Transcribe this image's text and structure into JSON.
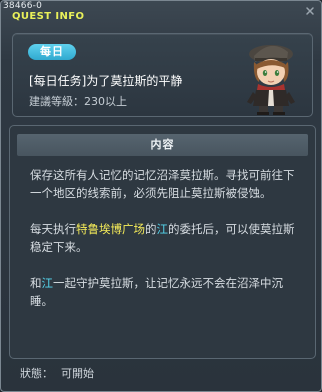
{
  "window": {
    "id": "38466-0",
    "title": "QUEST INFO"
  },
  "quest": {
    "badge": "每日",
    "name": "[每日任务]为了莫拉斯的平静",
    "level": "建議等級：230以上"
  },
  "content": {
    "header": "内容",
    "paragraphs": [
      {
        "segments": [
          {
            "text": "保存这所有人记忆的记忆沼泽莫拉斯。寻找可前往下一个地区的线索前，必须先阻止莫拉斯被侵蚀。",
            "style": "plain"
          }
        ]
      },
      {
        "segments": [
          {
            "text": "每天执行",
            "style": "plain"
          },
          {
            "text": "特鲁埃博广场",
            "style": "yellow"
          },
          {
            "text": "的",
            "style": "plain"
          },
          {
            "text": "江",
            "style": "cyan"
          },
          {
            "text": "的委托后，可以使莫拉斯稳定下来。",
            "style": "plain"
          }
        ]
      },
      {
        "segments": [
          {
            "text": "和",
            "style": "plain"
          },
          {
            "text": "江",
            "style": "cyan"
          },
          {
            "text": "一起守护莫拉斯，让记忆永远不会在沼泽中沉睡。",
            "style": "plain"
          }
        ]
      }
    ]
  },
  "status": {
    "label": "狀態：",
    "value": "可開始"
  },
  "colors": {
    "title": "#e9f05a",
    "badge": "#3fbfe2",
    "highlight_place": "#f6ec59",
    "highlight_npc": "#55d7f0"
  },
  "icons": {
    "close": "close-icon",
    "portrait": "npc-portrait"
  }
}
